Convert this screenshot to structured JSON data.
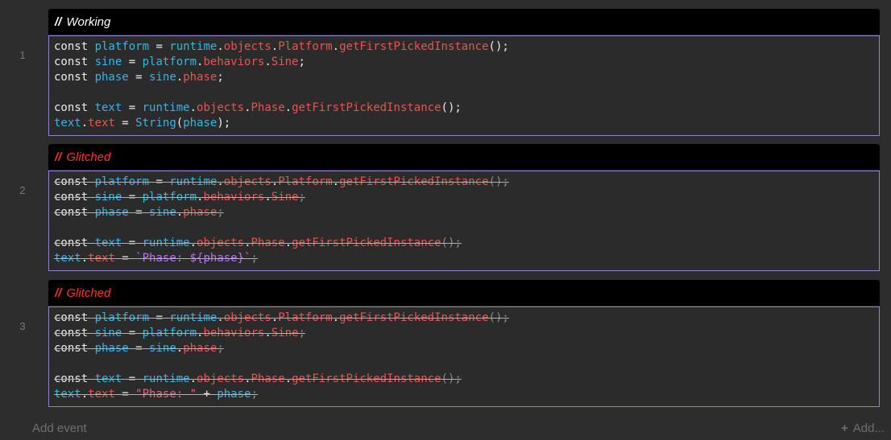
{
  "events": [
    {
      "number": "1",
      "comment": {
        "slashes": "//",
        "text": "Working",
        "color": "#ffffff"
      },
      "struck": false,
      "lines": [
        [
          {
            "t": "const ",
            "c": "kw"
          },
          {
            "t": "platform",
            "c": "var"
          },
          {
            "t": " = ",
            "c": "plain"
          },
          {
            "t": "runtime",
            "c": "var"
          },
          {
            "t": ".",
            "c": "plain"
          },
          {
            "t": "objects",
            "c": "prop"
          },
          {
            "t": ".",
            "c": "plain"
          },
          {
            "t": "Platform",
            "c": "obj"
          },
          {
            "t": ".",
            "c": "plain"
          },
          {
            "t": "getFirstPickedInstance",
            "c": "fn"
          },
          {
            "t": "();",
            "c": "punct"
          }
        ],
        [
          {
            "t": "const ",
            "c": "kw"
          },
          {
            "t": "sine",
            "c": "var"
          },
          {
            "t": " = ",
            "c": "plain"
          },
          {
            "t": "platform",
            "c": "var"
          },
          {
            "t": ".",
            "c": "plain"
          },
          {
            "t": "behaviors",
            "c": "prop"
          },
          {
            "t": ".",
            "c": "plain"
          },
          {
            "t": "Sine",
            "c": "obj"
          },
          {
            "t": ";",
            "c": "punct"
          }
        ],
        [
          {
            "t": "const ",
            "c": "kw"
          },
          {
            "t": "phase",
            "c": "var"
          },
          {
            "t": " = ",
            "c": "plain"
          },
          {
            "t": "sine",
            "c": "var"
          },
          {
            "t": ".",
            "c": "plain"
          },
          {
            "t": "phase",
            "c": "prop"
          },
          {
            "t": ";",
            "c": "punct"
          }
        ],
        [],
        [
          {
            "t": "const ",
            "c": "kw"
          },
          {
            "t": "text",
            "c": "var"
          },
          {
            "t": " = ",
            "c": "plain"
          },
          {
            "t": "runtime",
            "c": "var"
          },
          {
            "t": ".",
            "c": "plain"
          },
          {
            "t": "objects",
            "c": "prop"
          },
          {
            "t": ".",
            "c": "plain"
          },
          {
            "t": "Phase",
            "c": "obj"
          },
          {
            "t": ".",
            "c": "plain"
          },
          {
            "t": "getFirstPickedInstance",
            "c": "fn"
          },
          {
            "t": "();",
            "c": "punct"
          }
        ],
        [
          {
            "t": "text",
            "c": "var"
          },
          {
            "t": ".",
            "c": "plain"
          },
          {
            "t": "text",
            "c": "prop"
          },
          {
            "t": " = ",
            "c": "plain"
          },
          {
            "t": "String",
            "c": "builtin"
          },
          {
            "t": "(",
            "c": "punct"
          },
          {
            "t": "phase",
            "c": "var"
          },
          {
            "t": ");",
            "c": "punct"
          }
        ]
      ]
    },
    {
      "number": "2",
      "comment": {
        "slashes": "//",
        "text": "Glitched",
        "color": "#ff2e2e"
      },
      "struck": true,
      "lines": [
        [
          {
            "t": "const ",
            "c": "kw"
          },
          {
            "t": "platform",
            "c": "var"
          },
          {
            "t": " = ",
            "c": "plain"
          },
          {
            "t": "runtime",
            "c": "var"
          },
          {
            "t": ".",
            "c": "plain"
          },
          {
            "t": "objects",
            "c": "prop"
          },
          {
            "t": ".",
            "c": "plain"
          },
          {
            "t": "Platform",
            "c": "obj"
          },
          {
            "t": ".",
            "c": "plain"
          },
          {
            "t": "getFirstPickedInstance",
            "c": "fn"
          },
          {
            "t": "();",
            "c": "punct-dim"
          }
        ],
        [
          {
            "t": "const ",
            "c": "kw"
          },
          {
            "t": "sine",
            "c": "var"
          },
          {
            "t": " = ",
            "c": "plain"
          },
          {
            "t": "platform",
            "c": "var"
          },
          {
            "t": ".",
            "c": "plain"
          },
          {
            "t": "behaviors",
            "c": "prop"
          },
          {
            "t": ".",
            "c": "plain"
          },
          {
            "t": "Sine",
            "c": "obj"
          },
          {
            "t": ";",
            "c": "punct-dim"
          }
        ],
        [
          {
            "t": "const ",
            "c": "kw"
          },
          {
            "t": "phase",
            "c": "var"
          },
          {
            "t": " = ",
            "c": "plain"
          },
          {
            "t": "sine",
            "c": "var"
          },
          {
            "t": ".",
            "c": "plain"
          },
          {
            "t": "phase",
            "c": "prop"
          },
          {
            "t": ";",
            "c": "punct-dim"
          }
        ],
        [],
        [
          {
            "t": "const ",
            "c": "kw"
          },
          {
            "t": "text",
            "c": "var"
          },
          {
            "t": " = ",
            "c": "plain"
          },
          {
            "t": "runtime",
            "c": "var"
          },
          {
            "t": ".",
            "c": "plain"
          },
          {
            "t": "objects",
            "c": "prop"
          },
          {
            "t": ".",
            "c": "plain"
          },
          {
            "t": "Phase",
            "c": "obj"
          },
          {
            "t": ".",
            "c": "plain"
          },
          {
            "t": "getFirstPickedInstance",
            "c": "fn"
          },
          {
            "t": "();",
            "c": "punct-dim"
          }
        ],
        [
          {
            "t": "text",
            "c": "var"
          },
          {
            "t": ".",
            "c": "plain"
          },
          {
            "t": "text",
            "c": "prop"
          },
          {
            "t": " = ",
            "c": "plain"
          },
          {
            "t": "`Phase: ${phase}`",
            "c": "tpl"
          },
          {
            "t": ";",
            "c": "punct-dim"
          }
        ]
      ]
    },
    {
      "number": "3",
      "comment": {
        "slashes": "//",
        "text": "Glitched",
        "color": "#ff2e2e"
      },
      "struck": true,
      "lines": [
        [
          {
            "t": "const ",
            "c": "kw"
          },
          {
            "t": "platform",
            "c": "var"
          },
          {
            "t": " = ",
            "c": "plain"
          },
          {
            "t": "runtime",
            "c": "var"
          },
          {
            "t": ".",
            "c": "plain"
          },
          {
            "t": "objects",
            "c": "prop"
          },
          {
            "t": ".",
            "c": "plain"
          },
          {
            "t": "Platform",
            "c": "obj"
          },
          {
            "t": ".",
            "c": "plain"
          },
          {
            "t": "getFirstPickedInstance",
            "c": "fn"
          },
          {
            "t": "();",
            "c": "punct-dim"
          }
        ],
        [
          {
            "t": "const ",
            "c": "kw"
          },
          {
            "t": "sine",
            "c": "var"
          },
          {
            "t": " = ",
            "c": "plain"
          },
          {
            "t": "platform",
            "c": "var"
          },
          {
            "t": ".",
            "c": "plain"
          },
          {
            "t": "behaviors",
            "c": "prop"
          },
          {
            "t": ".",
            "c": "plain"
          },
          {
            "t": "Sine",
            "c": "obj"
          },
          {
            "t": ";",
            "c": "punct-dim"
          }
        ],
        [
          {
            "t": "const ",
            "c": "kw"
          },
          {
            "t": "phase",
            "c": "var"
          },
          {
            "t": " = ",
            "c": "plain"
          },
          {
            "t": "sine",
            "c": "var"
          },
          {
            "t": ".",
            "c": "plain"
          },
          {
            "t": "phase",
            "c": "prop"
          },
          {
            "t": ";",
            "c": "punct-dim"
          }
        ],
        [],
        [
          {
            "t": "const ",
            "c": "kw"
          },
          {
            "t": "text",
            "c": "var"
          },
          {
            "t": " = ",
            "c": "plain"
          },
          {
            "t": "runtime",
            "c": "var"
          },
          {
            "t": ".",
            "c": "plain"
          },
          {
            "t": "objects",
            "c": "prop"
          },
          {
            "t": ".",
            "c": "plain"
          },
          {
            "t": "Phase",
            "c": "obj"
          },
          {
            "t": ".",
            "c": "plain"
          },
          {
            "t": "getFirstPickedInstance",
            "c": "fn"
          },
          {
            "t": "();",
            "c": "punct-dim"
          }
        ],
        [
          {
            "t": "text",
            "c": "var"
          },
          {
            "t": ".",
            "c": "plain"
          },
          {
            "t": "text",
            "c": "prop"
          },
          {
            "t": " = ",
            "c": "plain"
          },
          {
            "t": "\"Phase: \"",
            "c": "str"
          },
          {
            "t": " + ",
            "c": "plain"
          },
          {
            "t": "phase",
            "c": "var"
          },
          {
            "t": ";",
            "c": "punct-dim"
          }
        ]
      ]
    }
  ],
  "footer": {
    "add_event_label": "Add event",
    "add_more_label": "Add...",
    "add_more_icon": "plus-icon"
  },
  "colors": {
    "background": "#2d2d2d",
    "comment_bar": "#000000",
    "code_border": "#8f83d8",
    "working_comment": "#ffffff",
    "glitched_comment": "#ff2e2e"
  }
}
